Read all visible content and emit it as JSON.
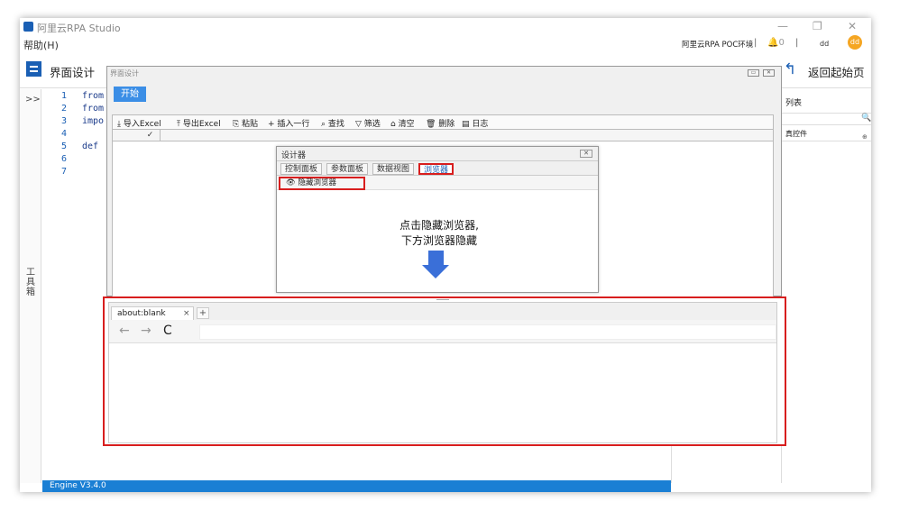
{
  "titlebar": {
    "title": "阿里云RPA Studio",
    "minimize": "—",
    "restore": "❐",
    "close": "✕"
  },
  "menubar": {
    "help": "帮助(H)",
    "env": "阿里云RPA POC环境",
    "sep": "|",
    "bell": "🔔0",
    "user": "dd",
    "avatar": "dd"
  },
  "toolbar": {
    "label": "界面设计",
    "back": "返回起始页"
  },
  "gutter": {
    "expand": ">>",
    "toolbox": "工具箱"
  },
  "editor": {
    "line_numbers": [
      "1",
      "2",
      "3",
      "4",
      "5",
      "6",
      "7"
    ],
    "code": [
      "from",
      "from",
      "impo",
      "",
      "def",
      "",
      ""
    ]
  },
  "right_panel": {
    "title": "列表",
    "search_icon": "🔍",
    "item": "真控件",
    "item_icon": "⊕"
  },
  "status": {
    "engine": "Engine V3.4.0"
  },
  "designer": {
    "title": "界面设计",
    "start": "开始",
    "toolbar": [
      "⤓ 导入Excel",
      "⤒ 导出Excel",
      "⎘ 粘贴",
      "+ 插入一行",
      "⌕ 查找",
      "▽ 筛选",
      "⌂ 清空",
      "🗑 删除",
      "▤ 日志"
    ],
    "checkbox": "✓",
    "btn_restore": "▭",
    "btn_close": "✕"
  },
  "dialog": {
    "title": "设计器",
    "close": "✕",
    "tabs": [
      "控制面板",
      "参数面板",
      "数据视图",
      "浏览器"
    ],
    "hide_browser": "👁 隐藏浏览器"
  },
  "annotation": {
    "line1": "点击隐藏浏览器,",
    "line2": "下方浏览器隐藏"
  },
  "browser": {
    "tab": "about:blank",
    "tab_close": "×",
    "new_tab": "+",
    "back": "←",
    "forward": "→",
    "reload": "C"
  }
}
